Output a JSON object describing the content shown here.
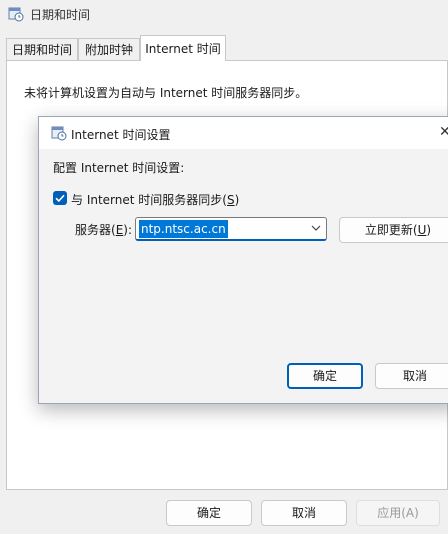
{
  "window": {
    "title": "日期和时间",
    "icon": "clock-calendar-icon"
  },
  "tabs": [
    {
      "label": "日期和时间",
      "active": false
    },
    {
      "label": "附加时钟",
      "active": false
    },
    {
      "label": "Internet 时间",
      "active": true
    }
  ],
  "panel": {
    "info": "未将计算机设置为自动与 Internet 时间服务器同步。"
  },
  "buttons": {
    "ok": "确定",
    "cancel": "取消",
    "apply": "应用(A)"
  },
  "dialog": {
    "title": "Internet 时间设置",
    "icon": "clock-calendar-icon",
    "heading": "配置 Internet 时间设置:",
    "sync_label_pre": "与 Internet 时间服务器同步(",
    "sync_label_key": "S",
    "sync_label_post": ")",
    "sync_checked": true,
    "server_label_pre": "服务器(",
    "server_label_key": "E",
    "server_label_post": "):",
    "server_value": "ntp.ntsc.ac.cn",
    "update_label_pre": "立即更新(",
    "update_label_key": "U",
    "update_label_post": ")",
    "ok": "确定",
    "cancel": "取消",
    "accent": "#005fb8"
  }
}
